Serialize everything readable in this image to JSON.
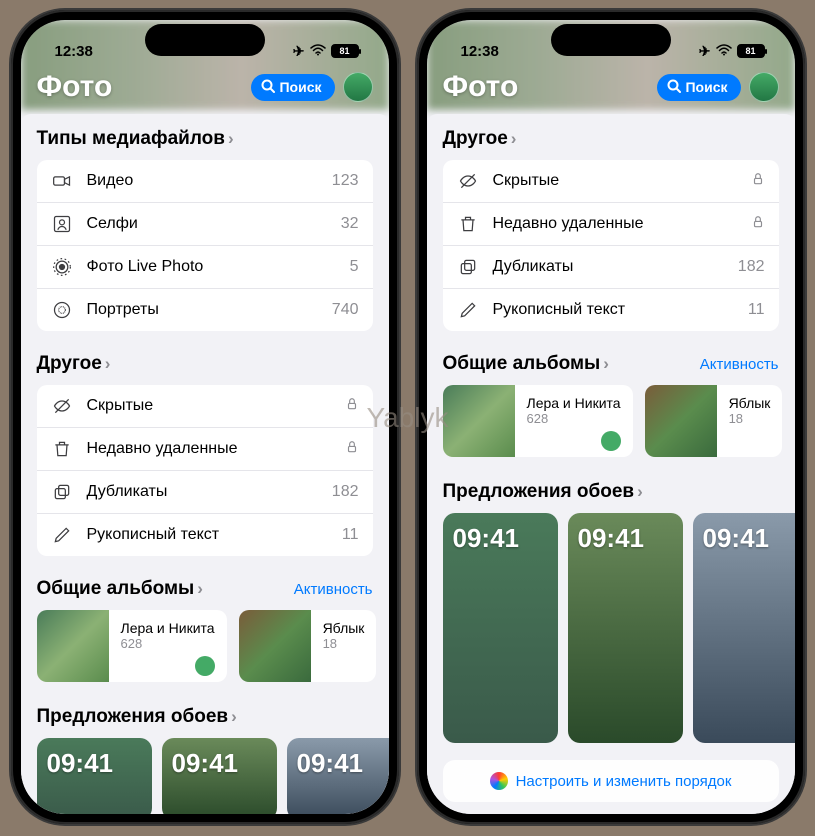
{
  "watermark": "Yablyk",
  "status": {
    "time": "12:38",
    "battery": "81"
  },
  "header": {
    "title": "Фото",
    "search": "Поиск"
  },
  "mediaTypes": {
    "title": "Типы медиафайлов",
    "items": [
      {
        "label": "Видео",
        "count": "123"
      },
      {
        "label": "Селфи",
        "count": "32"
      },
      {
        "label": "Фото Live Photo",
        "count": "5"
      },
      {
        "label": "Портреты",
        "count": "740"
      }
    ]
  },
  "other": {
    "title": "Другое",
    "items": [
      {
        "label": "Скрытые",
        "locked": true
      },
      {
        "label": "Недавно удаленные",
        "locked": true
      },
      {
        "label": "Дубликаты",
        "count": "182"
      },
      {
        "label": "Рукописный текст",
        "count": "11"
      }
    ]
  },
  "sharedAlbums": {
    "title": "Общие альбомы",
    "activity": "Активность",
    "albums": [
      {
        "name": "Лера и Никита",
        "count": "628"
      },
      {
        "name": "Яблык",
        "count": "18"
      }
    ]
  },
  "wallpapers": {
    "title": "Предложения обоев",
    "time": "09:41"
  },
  "customize": "Настроить и изменить порядок"
}
